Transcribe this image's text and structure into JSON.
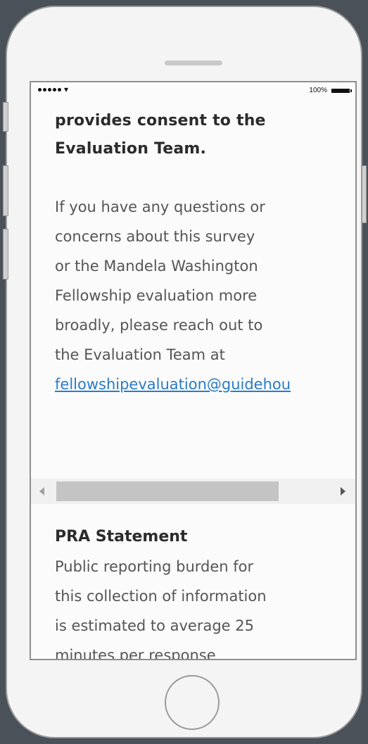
{
  "status_bar": {
    "signal_icon": "signal-dots-icon",
    "wifi_icon": "wifi-icon",
    "battery_label": "100%",
    "battery_icon": "battery-icon"
  },
  "content": {
    "consent_lines": [
      "provides consent to the",
      "Evaluation Team."
    ],
    "contact_lines": [
      "If you have any questions or",
      "concerns about this survey",
      "or the Mandela Washington",
      "Fellowship evaluation more",
      "broadly, please reach out to",
      "the Evaluation Team at"
    ],
    "contact_link": "fellowshipevaluation@guidehou",
    "pra_title": "PRA Statement",
    "pra_lines": [
      "Public reporting burden for",
      "this collection of information",
      "is estimated to average 25",
      "minutes per response"
    ]
  },
  "scrollbar": {
    "left_arrow_icon": "chevron-left-icon",
    "right_arrow_icon": "chevron-right-icon"
  },
  "device": {
    "home_button_icon": "home-button-icon"
  }
}
